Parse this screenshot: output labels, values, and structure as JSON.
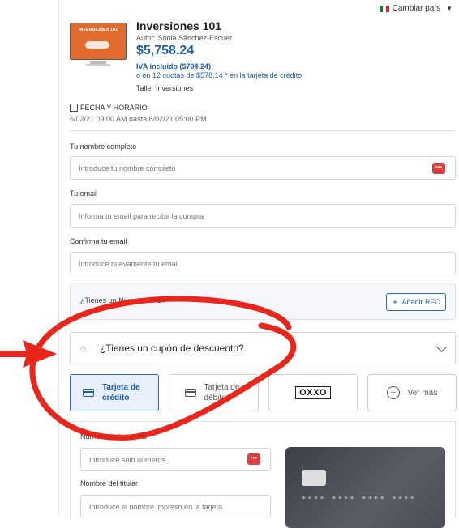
{
  "header": {
    "country_label": "Cambiar país"
  },
  "product": {
    "thumbnail_text": "INVERSIONES 101",
    "name": "Inversiones 101",
    "author": "Autor: Sonia Sánchez-Escuer",
    "price": "$5,758.24",
    "tax_note": "IVA incluido ($794.24)",
    "installments": "o en 12 cuotas de $578.14 * en la tarjeta de crédito",
    "workshop": "Taller Inversiones"
  },
  "schedule": {
    "heading": "FECHA Y HORARIO",
    "range": "6/02/21 09:00 AM hasta 6/02/21 05:00 PM"
  },
  "form": {
    "name_label": "Tu nombre completo",
    "name_placeholder": "Introduce tu nombre completo",
    "email_label": "Tu email",
    "email_placeholder": "Informa tu email para recibir la compra",
    "confirm_label": "Confirma tu email",
    "confirm_placeholder": "Introduce nuevamente tu email",
    "rfc_question": "¿Tienes un Número RFC?",
    "rfc_button": "Añadir RFC",
    "coupon_text": "¿Tienes un cupón de descuento?"
  },
  "payment_methods": [
    {
      "label": "Tarjeta de crédito",
      "selected": true
    },
    {
      "label": "Tarjeta de débito",
      "selected": false
    },
    {
      "label": "OXXO",
      "selected": false
    },
    {
      "label": "Ver más",
      "selected": false
    }
  ],
  "card_form": {
    "number_label": "Número de la tarjeta",
    "number_placeholder": "Introduce solo números",
    "holder_label": "Nombre del titular",
    "holder_placeholder": "Introduce el nombre impreso en la tarjeta",
    "preview_number": "**** **** **** ****"
  },
  "colors": {
    "accent": "#1b5fa8",
    "annotation": "#e8261b",
    "card_bg": "#4a4d55"
  }
}
